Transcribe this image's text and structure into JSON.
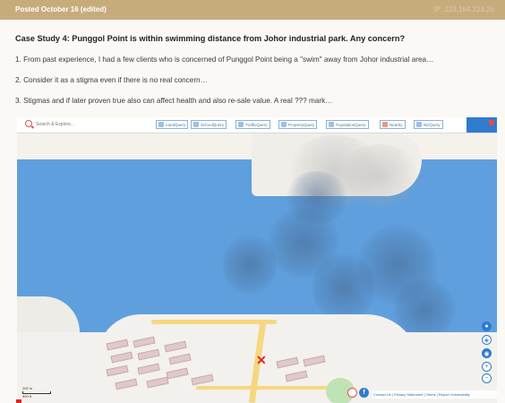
{
  "header": {
    "posted": "Posted October 16 (edited)",
    "ip": "IP: 223.164.223.26"
  },
  "post": {
    "title": "Case Study 4:  Punggol Point is within swimming distance from Johor industrial park. Any concern?",
    "points": [
      "1. From past experience, I had a few clients who is concerned of Punggol Point being a \"swim\" away from Johor industrial area…",
      "2. Consider it as a stigma even if there is no real concern…",
      "3. Stigmas and if later proven true also can affect health and also re-sale value. A real ??? mark…"
    ]
  },
  "map": {
    "search_placeholder": "Search & Explore...",
    "query_buttons": [
      "LandQuery",
      "SchoolQuery",
      "TrafficQuery",
      "PropertyQuery",
      "PopulationQuery",
      "Nearby",
      "BizQuery"
    ],
    "marker": "✕",
    "attribution": "Contact Us | Privacy Statement | Terms | Report Vulnerability",
    "scale": [
      "200 m",
      "500 ft"
    ],
    "controls": [
      "+",
      "−"
    ],
    "fb": "f"
  },
  "colors": {
    "water": "#5f9fdd",
    "land": "#f3f1ed",
    "accent": "#c7ac7b",
    "marker": "#e02424"
  }
}
